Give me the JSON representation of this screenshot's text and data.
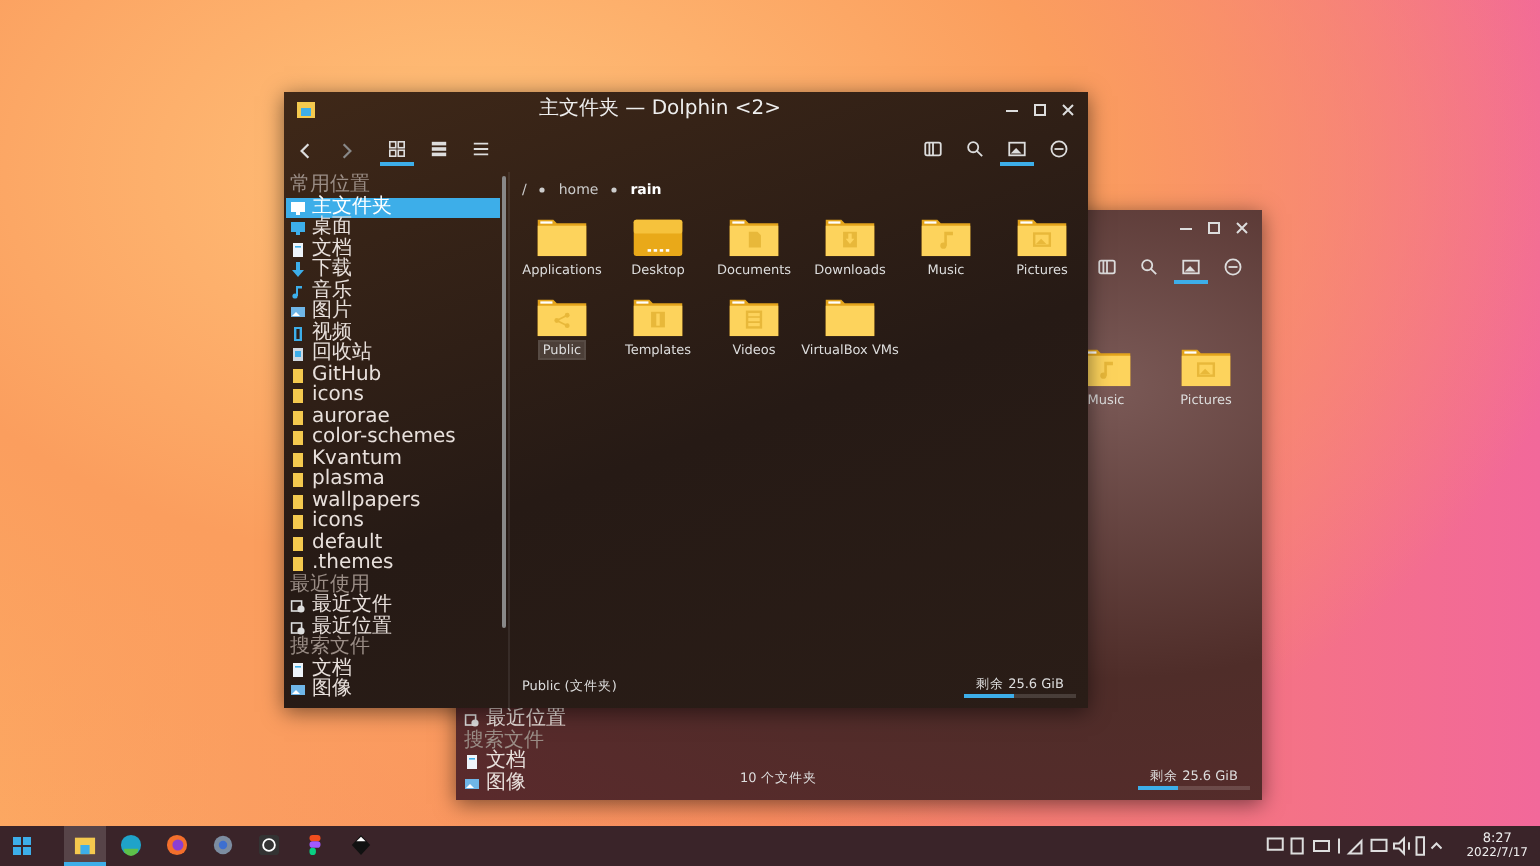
{
  "back_window": {
    "toolbar_actions": [
      {
        "kind": "split",
        "selected": false
      },
      {
        "kind": "search",
        "selected": false
      },
      {
        "kind": "preview",
        "selected": true
      },
      {
        "kind": "menu",
        "selected": false
      }
    ],
    "folders": [
      {
        "name": "Music",
        "kind": "music",
        "selected": false
      },
      {
        "name": "Pictures",
        "kind": "pictures",
        "selected": false
      }
    ],
    "sidebar": [
      {
        "label": "最近位置",
        "kind": "recent-place"
      },
      {
        "label": "搜索文件",
        "kind": "heading"
      },
      {
        "label": "文档",
        "kind": "document"
      },
      {
        "label": "图像",
        "kind": "picture"
      }
    ],
    "status_text": "10 个文件夹",
    "free_space": "剩余 25.6 GiB",
    "level": 0.35
  },
  "window": {
    "title": "主文件夹 — Dolphin <2>",
    "view_modes": [
      {
        "kind": "icons",
        "selected": true
      },
      {
        "kind": "compact",
        "selected": false
      },
      {
        "kind": "details",
        "selected": false
      }
    ],
    "toolbar_actions": [
      {
        "kind": "split",
        "selected": false
      },
      {
        "kind": "search",
        "selected": false
      },
      {
        "kind": "preview",
        "selected": true
      },
      {
        "kind": "menu",
        "selected": false
      }
    ],
    "sidebar": [
      {
        "label": "常用位置",
        "kind": "heading"
      },
      {
        "label": "主文件夹",
        "kind": "home",
        "selected": true
      },
      {
        "label": "桌面",
        "kind": "desktop",
        "selected": false
      },
      {
        "label": "文档",
        "kind": "document",
        "selected": false
      },
      {
        "label": "下载",
        "kind": "download",
        "selected": false
      },
      {
        "label": "音乐",
        "kind": "music",
        "selected": false
      },
      {
        "label": "图片",
        "kind": "picture",
        "selected": false
      },
      {
        "label": "视频",
        "kind": "video",
        "selected": false
      },
      {
        "label": "回收站",
        "kind": "trash",
        "selected": false
      },
      {
        "label": "GitHub",
        "kind": "folder",
        "selected": false
      },
      {
        "label": "icons",
        "kind": "folder",
        "selected": false
      },
      {
        "label": "aurorae",
        "kind": "folder",
        "selected": false
      },
      {
        "label": "color-schemes",
        "kind": "folder",
        "selected": false
      },
      {
        "label": "Kvantum",
        "kind": "folder",
        "selected": false
      },
      {
        "label": "plasma",
        "kind": "folder",
        "selected": false
      },
      {
        "label": "wallpapers",
        "kind": "folder",
        "selected": false
      },
      {
        "label": "icons",
        "kind": "folder",
        "selected": false
      },
      {
        "label": "default",
        "kind": "folder",
        "selected": false
      },
      {
        "label": ".themes",
        "kind": "folder",
        "selected": false
      },
      {
        "label": "最近使用",
        "kind": "heading"
      },
      {
        "label": "最近文件",
        "kind": "recent-file",
        "selected": false
      },
      {
        "label": "最近位置",
        "kind": "recent-place",
        "selected": false
      },
      {
        "label": "搜索文件",
        "kind": "heading"
      },
      {
        "label": "文档",
        "kind": "document",
        "selected": false
      },
      {
        "label": "图像",
        "kind": "picture",
        "selected": false
      }
    ],
    "breadcrumb": [
      "/",
      "home",
      "rain"
    ],
    "folders": [
      {
        "name": "Applications",
        "kind": "plain",
        "selected": false
      },
      {
        "name": "Desktop",
        "kind": "desktop",
        "selected": false
      },
      {
        "name": "Documents",
        "kind": "documents",
        "selected": false
      },
      {
        "name": "Downloads",
        "kind": "downloads",
        "selected": false
      },
      {
        "name": "Music",
        "kind": "music",
        "selected": false
      },
      {
        "name": "Pictures",
        "kind": "pictures",
        "selected": false
      },
      {
        "name": "Public",
        "kind": "public",
        "selected": true
      },
      {
        "name": "Templates",
        "kind": "templates",
        "selected": false
      },
      {
        "name": "Videos",
        "kind": "videos",
        "selected": false
      },
      {
        "name": "VirtualBox VMs",
        "kind": "plain",
        "selected": false
      }
    ],
    "status_text": "Public (文件夹)",
    "free_space": "剩余 25.6 GiB",
    "level": 0.45
  },
  "taskbar": {
    "apps": [
      {
        "kind": "file-manager",
        "selected": true
      },
      {
        "kind": "edge",
        "selected": false
      },
      {
        "kind": "firefox",
        "selected": false
      },
      {
        "kind": "settings",
        "selected": false
      },
      {
        "kind": "github",
        "selected": false
      },
      {
        "kind": "figma",
        "selected": false
      },
      {
        "kind": "inkscape",
        "selected": false
      }
    ],
    "time": "8:27",
    "date": "2022/7/17"
  }
}
